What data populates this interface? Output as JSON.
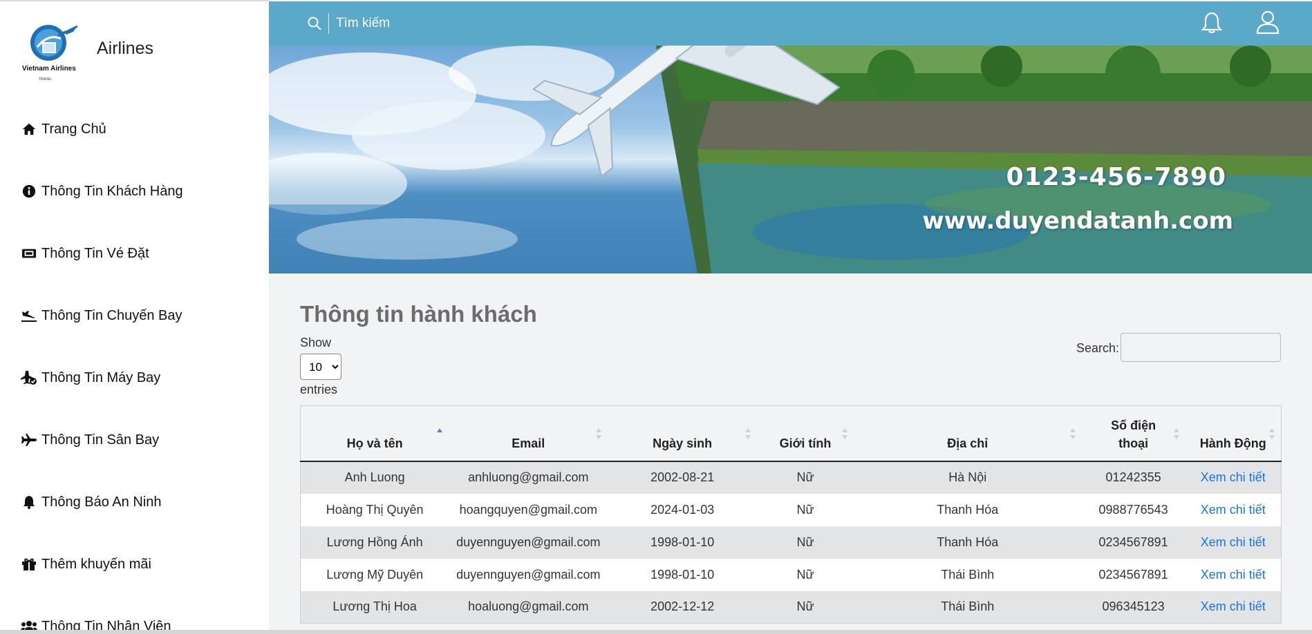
{
  "sidebar": {
    "brand": {
      "name": "Airlines",
      "logo_text": "Vietnam Airlines",
      "logo_subtext": "TRAVEL"
    },
    "items": [
      {
        "label": "Trang Chủ",
        "icon": "home-icon"
      },
      {
        "label": "Thông Tin Khách Hàng",
        "icon": "info-icon"
      },
      {
        "label": "Thông Tin Vé Đặt",
        "icon": "ticket-icon"
      },
      {
        "label": "Thông Tin Chuyến Bay",
        "icon": "plane-landing-icon"
      },
      {
        "label": "Thông Tin Máy Bay",
        "icon": "plane-check-icon"
      },
      {
        "label": "Thông Tin Sân Bay",
        "icon": "plane-icon"
      },
      {
        "label": "Thông Báo An Ninh",
        "icon": "bell-icon"
      },
      {
        "label": "Thêm khuyến mãi",
        "icon": "gift-icon"
      },
      {
        "label": "Thông Tin Nhân Viên",
        "icon": "users-icon"
      }
    ]
  },
  "topbar": {
    "search_placeholder": "Tìm kiếm",
    "notification_icon": "bell-icon",
    "user_icon": "user-icon",
    "color": "#5aa9c9"
  },
  "banner": {
    "phone": "0123-456-7890",
    "website": "www.duyendatanh.com"
  },
  "main": {
    "title": "Thông tin hành khách",
    "length": {
      "show_label": "Show",
      "selected": "10",
      "entries_label": "entries"
    },
    "filter": {
      "label": "Search:",
      "value": ""
    },
    "table": {
      "columns": [
        "Họ và tên",
        "Email",
        "Ngày sinh",
        "Giới tính",
        "Địa chỉ",
        "Số điện thoại",
        "Hành Động"
      ],
      "sorted_column": "Họ và tên",
      "rows": [
        {
          "name": "Anh Luong",
          "email": "anhluong@gmail.com",
          "dob": "2002-08-21",
          "gender": "Nữ",
          "address": "Hà Nội",
          "phone": "01242355",
          "action": "Xem chi tiết"
        },
        {
          "name": "Hoàng Thị Quyên",
          "email": "hoangquyen@gmail.com",
          "dob": "2024-01-03",
          "gender": "Nữ",
          "address": "Thanh Hóa",
          "phone": "0988776543",
          "action": "Xem chi tiết"
        },
        {
          "name": "Lương Hồng Ánh",
          "email": "duyennguyen@gmail.com",
          "dob": "1998-01-10",
          "gender": "Nữ",
          "address": "Thanh Hóa",
          "phone": "0234567891",
          "action": "Xem chi tiết"
        },
        {
          "name": "Lương Mỹ Duyên",
          "email": "duyennguyen@gmail.com",
          "dob": "1998-01-10",
          "gender": "Nữ",
          "address": "Thái Bình",
          "phone": "0234567891",
          "action": "Xem chi tiết"
        },
        {
          "name": "Lương Thị Hoa",
          "email": "hoaluong@gmail.com",
          "dob": "2002-12-12",
          "gender": "Nữ",
          "address": "Thái Bình",
          "phone": "096345123",
          "action": "Xem chi tiết"
        }
      ]
    }
  },
  "colors": {
    "accent": "#5aa9c9",
    "link": "#1a73e8",
    "stripe": "#e3e4e6"
  }
}
